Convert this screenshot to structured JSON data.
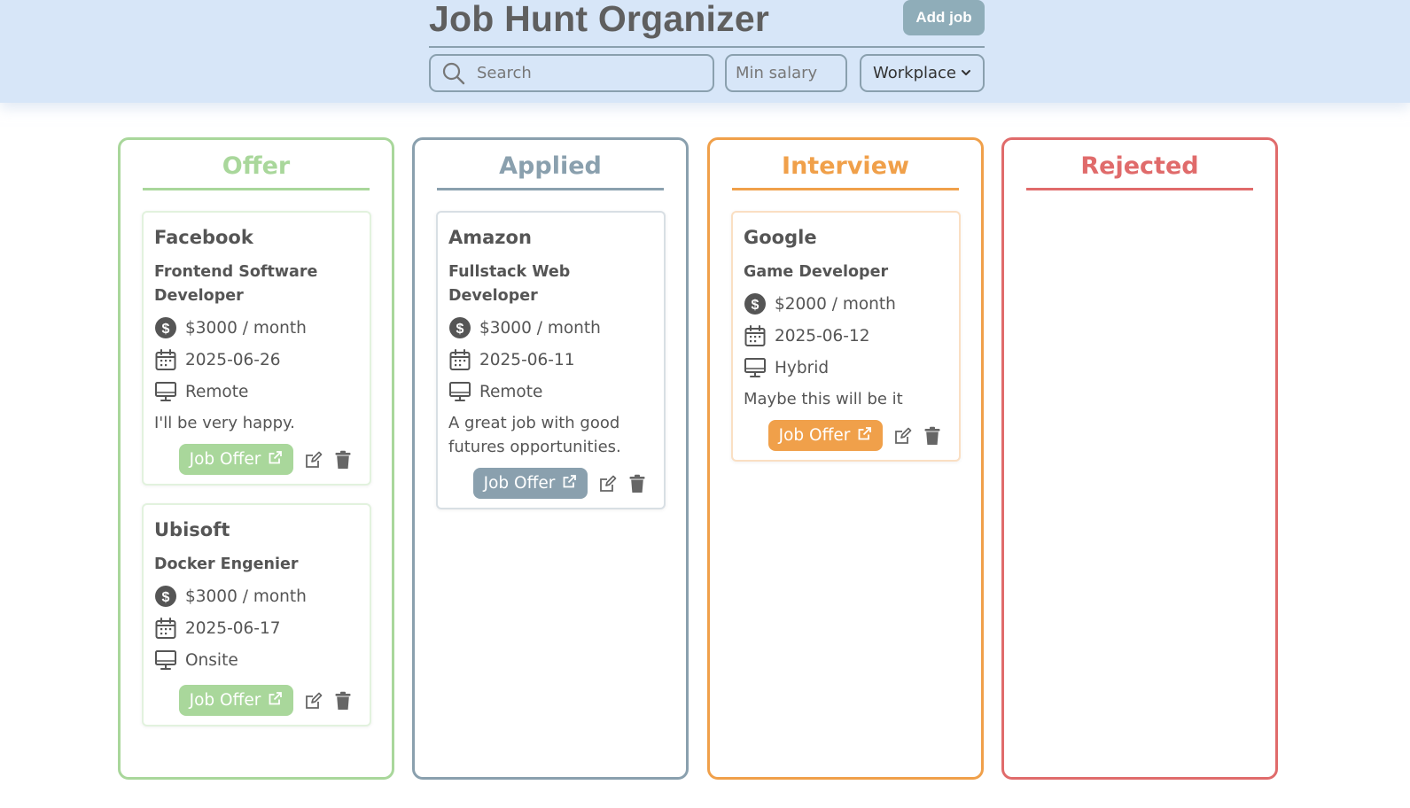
{
  "header": {
    "title": "Job Hunt Organizer",
    "add_label": "Add job",
    "search_placeholder": "Search",
    "salary_placeholder": "Min salary",
    "workplace_label": "Workplace"
  },
  "colors": {
    "header_bg": "#d7e6f8",
    "offer": "#a9d79b",
    "applied": "#8aa0ae",
    "interview": "#f0a04a",
    "rejected": "#e06b6b"
  },
  "columns": [
    {
      "title": "Offer",
      "cards": [
        {
          "company": "Facebook",
          "role": "Frontend Software Developer",
          "salary": "$3000 / month",
          "date": "2025-06-26",
          "workplace": "Remote",
          "note": "I'll be very happy.",
          "link_label": "Job Offer"
        },
        {
          "company": "Ubisoft",
          "role": "Docker Engenier",
          "salary": "$3000 / month",
          "date": "2025-06-17",
          "workplace": "Onsite",
          "note": "",
          "link_label": "Job Offer"
        }
      ]
    },
    {
      "title": "Applied",
      "cards": [
        {
          "company": "Amazon",
          "role": "Fullstack Web Developer",
          "salary": "$3000 / month",
          "date": "2025-06-11",
          "workplace": "Remote",
          "note": "A great job with good futures opportunities.",
          "link_label": "Job Offer"
        }
      ]
    },
    {
      "title": "Interview",
      "cards": [
        {
          "company": "Google",
          "role": "Game Developer",
          "salary": "$2000 / month",
          "date": "2025-06-12",
          "workplace": "Hybrid",
          "note": "Maybe this will be it",
          "link_label": "Job Offer"
        }
      ]
    },
    {
      "title": "Rejected",
      "cards": []
    }
  ]
}
